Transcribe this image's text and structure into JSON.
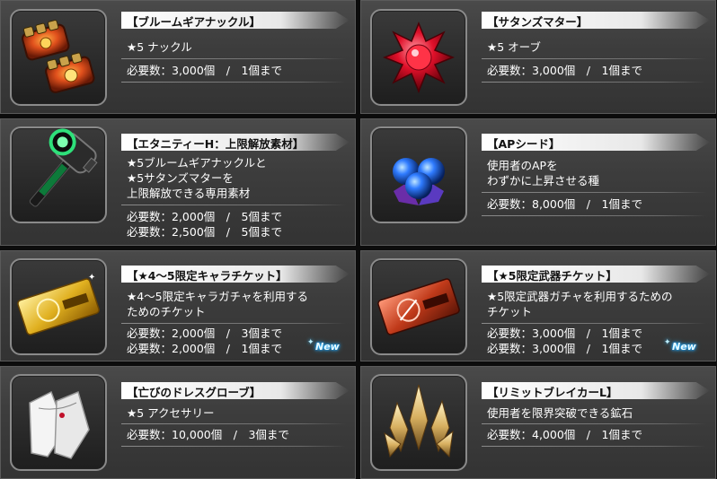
{
  "items": [
    {
      "title": "【ブルームギアナックル】",
      "lines": [
        "★5 ナックル"
      ],
      "reqs": [
        "必要数：3,000個　/　1個まで"
      ],
      "icon": "bloom-gear-knuckle-icon"
    },
    {
      "title": "【サタンズマター】",
      "lines": [
        "★5 オーブ"
      ],
      "reqs": [
        "必要数：3,000個　/　1個まで"
      ],
      "icon": "satans-matter-orb-icon"
    },
    {
      "title": "【エタニティーH：上限解放素材】",
      "lines": [
        "★5ブルームギアナックルと",
        "★5サタンズマターを",
        "上限解放できる専用素材"
      ],
      "reqs": [
        "必要数：2,000個　/　5個まで",
        "必要数：2,500個　/　5個まで"
      ],
      "icon": "eternity-hammer-icon"
    },
    {
      "title": "【APシード】",
      "lines": [
        "使用者のAPを",
        "わずかに上昇させる種"
      ],
      "reqs": [
        "必要数：8,000個　/　1個まで"
      ],
      "icon": "ap-seed-icon"
    },
    {
      "title": "【★4～5限定キャラチケット】",
      "lines": [
        "★4～5限定キャラガチャを利用する",
        "ためのチケット"
      ],
      "reqs": [
        "必要数：2,000個　/　3個まで",
        "必要数：2,000個　/　1個まで"
      ],
      "badge": "New",
      "icon": "gold-character-ticket-icon"
    },
    {
      "title": "【★5限定武器チケット】",
      "lines": [
        "★5限定武器ガチャを利用するための",
        "チケット"
      ],
      "reqs": [
        "必要数：3,000個　/　1個まで",
        "必要数：3,000個　/　1個まで"
      ],
      "badge": "New",
      "icon": "red-weapon-ticket-icon"
    },
    {
      "title": "【亡びのドレスグローブ】",
      "lines": [
        "★5 アクセサリー"
      ],
      "reqs": [
        "必要数：10,000個　/　3個まで"
      ],
      "icon": "dress-gloves-icon"
    },
    {
      "title": "【リミットブレイカーL】",
      "lines": [
        "使用者を限界突破できる鉱石"
      ],
      "reqs": [
        "必要数：4,000個　/　1個まで"
      ],
      "icon": "limit-breaker-crystal-icon"
    }
  ]
}
